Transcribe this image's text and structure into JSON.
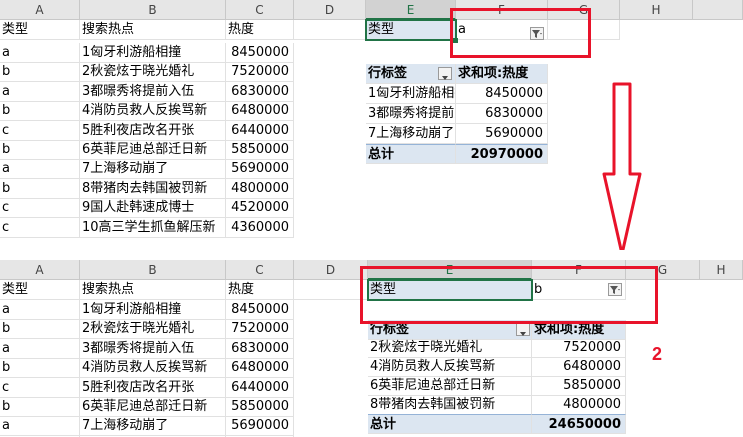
{
  "columns": {
    "a": "A",
    "b": "B",
    "c": "C",
    "d": "D",
    "e": "E",
    "f": "F",
    "g": "G",
    "h": "H"
  },
  "source": {
    "headers": [
      "类型",
      "搜索热点",
      "热度"
    ],
    "rows": [
      [
        "a",
        "1匈牙利游船相撞",
        "8450000"
      ],
      [
        "b",
        "2秋瓷炫于晓光婚礼",
        "7520000"
      ],
      [
        "a",
        "3都暻秀将提前入伍",
        "6830000"
      ],
      [
        "b",
        "4消防员救人反挨骂新",
        "6480000"
      ],
      [
        "c",
        "5胜利夜店改名开张",
        "6440000"
      ],
      [
        "b",
        "6英菲尼迪总部迁日新",
        "5850000"
      ],
      [
        "a",
        "7上海移动崩了",
        "5690000"
      ],
      [
        "b",
        "8带猪肉去韩国被罚新",
        "4800000"
      ],
      [
        "c",
        "9国人赴韩速成博士",
        "4520000"
      ],
      [
        "c",
        "10高三学生抓鱼解压新",
        "4360000"
      ]
    ]
  },
  "top_pivot": {
    "filter_label": "类型",
    "filter_value": "a",
    "row_label_header": "行标签",
    "sum_header": "求和项:热度",
    "rows": [
      [
        "1匈牙利游船相撞",
        "8450000"
      ],
      [
        "3都暻秀将提前入伍",
        "6830000"
      ],
      [
        "7上海移动崩了",
        "5690000"
      ]
    ],
    "total_label": "总计",
    "total_value": "20970000"
  },
  "bottom_pivot": {
    "filter_label": "类型",
    "filter_value": "b",
    "row_label_header": "行标签",
    "sum_header": "求和项:热度",
    "rows": [
      [
        "2秋瓷炫于晓光婚礼",
        "7520000"
      ],
      [
        "4消防员救人反挨骂新",
        "6480000"
      ],
      [
        "6英菲尼迪总部迁日新",
        "5850000"
      ],
      [
        "8带猪肉去韩国被罚新",
        "4800000"
      ]
    ],
    "total_label": "总计",
    "total_value": "24650000"
  },
  "annotation": {
    "step_number": "2"
  },
  "colors": {
    "red": "#e8132a",
    "excel_green": "#217346",
    "pivot_blue": "#dce6f1"
  },
  "icons": {
    "filter": "funnel-icon",
    "dropdown": "chevron-down-icon",
    "arrow": "down-arrow-icon"
  }
}
